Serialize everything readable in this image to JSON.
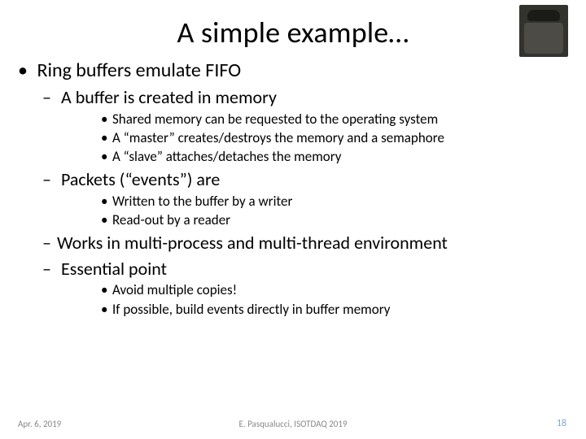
{
  "title": "A simple example…",
  "corner_image_alt": "Rosetta Stone thumbnail",
  "l1": {
    "i0": {
      "text": "Ring buffers emulate FIFO",
      "l2": {
        "i0": {
          "text": "A buffer is created in memory",
          "l3": {
            "i0": "Shared memory can be requested to the operating system",
            "i1": "A “master” creates/destroys the memory and a semaphore",
            "i2": "A “slave” attaches/detaches the memory"
          }
        },
        "i1": {
          "text": "Packets (“events”) are",
          "l3": {
            "i0": "Written to the buffer by a writer",
            "i1": "Read-out  by a reader"
          }
        },
        "i2": {
          "text": "Works in multi-process and multi-thread environment"
        },
        "i3": {
          "text": "Essential point",
          "l3": {
            "i0": "Avoid multiple copies!",
            "i1": "If possible, build events directly in buffer memory"
          }
        }
      }
    }
  },
  "footer": {
    "date": "Apr. 6, 2019",
    "center": "E. Pasqualucci, ISOTDAQ 2019",
    "page": "18"
  }
}
